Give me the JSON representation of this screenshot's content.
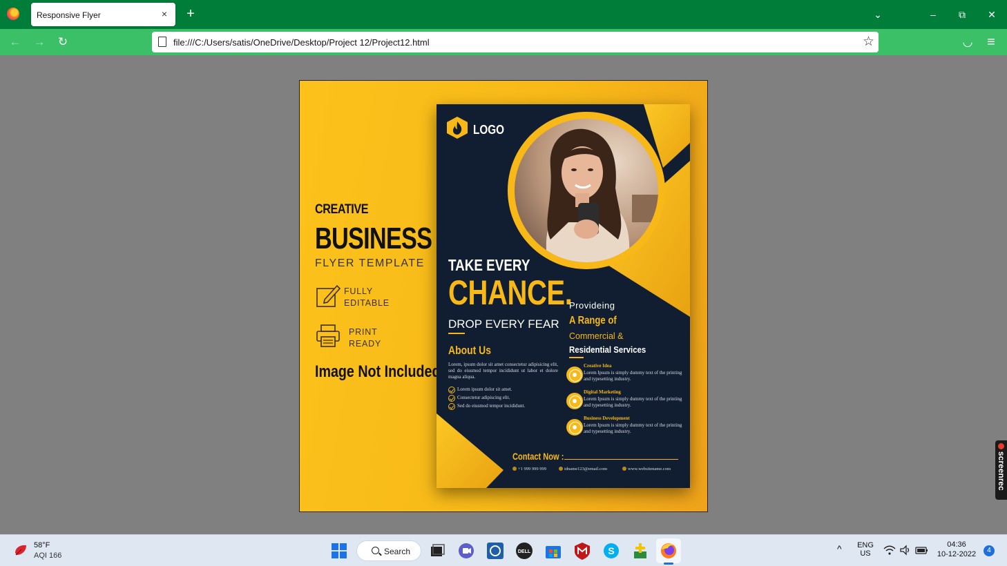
{
  "browser": {
    "tab_title": "Responsive Flyer",
    "tab_close": "×",
    "new_tab": "+",
    "url": "file:///C:/Users/satis/OneDrive/Desktop/Project 12/Project12.html",
    "window_buttons": {
      "list": "⌄",
      "minimize": "–",
      "restore": "⧉",
      "close": "✕"
    },
    "nav": {
      "back": "←",
      "forward": "→",
      "reload": "↻"
    },
    "star": "☆",
    "right_icons": {
      "pocket": "◡",
      "menu": "≡"
    }
  },
  "promo": {
    "creative": "CREATIVE",
    "business": "BUSINESS",
    "flyer_template": "FLYER TEMPLATE",
    "features": [
      {
        "line1": "FULLY",
        "line2": "EDITABLE",
        "icon": "edit-icon"
      },
      {
        "line1": "PRINT",
        "line2": "READY",
        "icon": "printer-icon"
      }
    ],
    "image_note": "Image Not Included"
  },
  "flyer": {
    "logo": "LOGO",
    "headline_1": "TAKE EVERY",
    "headline_2": "CHANCE.",
    "headline_3": "DROP EVERY FEAR",
    "about_title": "About Us",
    "about_text": "Lorem, ipsum dolor sit amet consectetur adipisicing elit, sed do eiusmod tempor incididunt ut labor et dolore magna aliqua.",
    "checklist": [
      "Lorem ipsum dolor sit amet.",
      "Consectetur adipiscing elit.",
      "Sed do eiusmod tempor incididunt."
    ],
    "providing": "Provideing",
    "range": "A Range of",
    "commercial": "Commercial &",
    "residential": "Residential Services",
    "services": [
      {
        "title": "Creative Idea",
        "desc": "Lorem Ipsum is simply dummy text of the printing and typesetting industry."
      },
      {
        "title": "Digital Marketing",
        "desc": "Lorem Ipsum is simply dummy text of the printing and typesetting industry."
      },
      {
        "title": "Business Development",
        "desc": "Lorem Ipsum is simply dummy text of the printing and typesetting industry."
      }
    ],
    "contact_label": "Contact Now :",
    "phone": "+1 999 999 999",
    "email": "idname123@email.com",
    "website": "www.websitename.com"
  },
  "screenrec": "screenrec",
  "taskbar": {
    "temperature": "58°F",
    "aqi": "AQI 166",
    "search": "Search",
    "lang_1": "ENG",
    "lang_2": "US",
    "time": "04:36",
    "date": "10-12-2022",
    "notifications": "4",
    "tray_chevron": "^"
  },
  "colors": {
    "chrome_green": "#017d3a",
    "nav_green": "#3bbf67",
    "flyer_navy": "#111e31",
    "accent_yellow": "#f7b818"
  }
}
